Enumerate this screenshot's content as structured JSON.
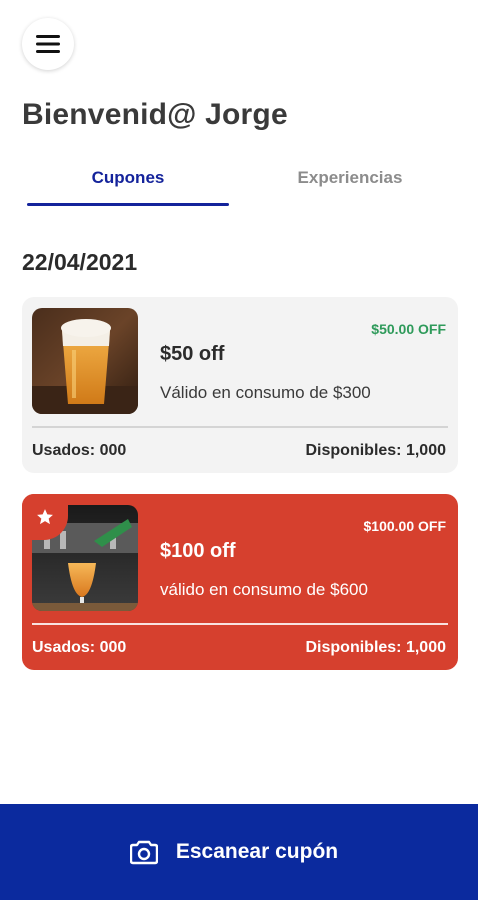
{
  "header": {
    "menu_icon": "hamburger-menu-icon",
    "welcome": "Bienvenid@ Jorge"
  },
  "tabs": [
    {
      "label": "Cupones",
      "active": true
    },
    {
      "label": "Experiencias",
      "active": false
    }
  ],
  "date": "22/04/2021",
  "coupons": [
    {
      "off_label": "$50.00 OFF",
      "title": "$50 off",
      "description": "Válido en consumo de $300",
      "used": "Usados: 000",
      "available": "Disponibles: 1,000",
      "featured": false,
      "image": "glass-of-beer-image",
      "background": "#f3f3f3"
    },
    {
      "off_label": "$100.00 OFF",
      "title": "$100 off",
      "description": "válido en consumo de $600",
      "used": "Usados: 000",
      "available": "Disponibles: 1,000",
      "featured": true,
      "featured_icon": "star-icon",
      "image": "beer-pouring-image",
      "background": "#d6402e"
    }
  ],
  "footer": {
    "scan_icon": "camera-icon",
    "scan_label": "Escanear cupón"
  },
  "colors": {
    "primary": "#14239b",
    "footer": "#0b2a9e",
    "accent_red": "#d6402e",
    "discount_green": "#2e9a5a"
  }
}
